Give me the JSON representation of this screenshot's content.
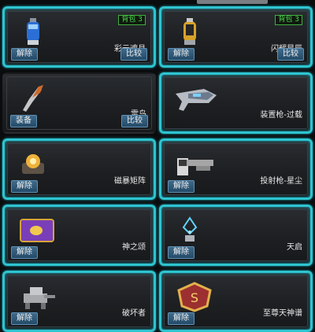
{
  "items": [
    {
      "name": "彩云遮月",
      "badge": "背包 3",
      "primary": "解除",
      "secondary": "比较",
      "icon": "blue-armor-icon",
      "selected": true
    },
    {
      "name": "闪耀星辰",
      "badge": "背包 3",
      "primary": "解除",
      "secondary": "比较",
      "icon": "gold-armor-icon",
      "selected": true
    },
    {
      "name": "雷鸟",
      "badge": "",
      "primary": "装备",
      "secondary": "比较",
      "icon": "thunderbird-weapon-icon",
      "selected": false
    },
    {
      "name": "装置枪-过载",
      "badge": "",
      "primary": "",
      "secondary": "",
      "icon": "device-gun-overload-icon",
      "selected": true
    },
    {
      "name": "磁暴矩阵",
      "badge": "",
      "primary": "解除",
      "secondary": "",
      "icon": "magnetic-matrix-icon",
      "selected": true
    },
    {
      "name": "投射枪-星尘",
      "badge": "",
      "primary": "解除",
      "secondary": "",
      "icon": "projectile-gun-stardust-icon",
      "selected": true
    },
    {
      "name": "神之颂",
      "badge": "",
      "primary": "解除",
      "secondary": "",
      "icon": "purple-scroll-icon",
      "selected": true
    },
    {
      "name": "天启",
      "badge": "",
      "primary": "解除",
      "secondary": "",
      "icon": "apocalypse-pet-icon",
      "selected": true
    },
    {
      "name": "破坏者",
      "badge": "",
      "primary": "解除",
      "secondary": "",
      "icon": "destroyer-mech-icon",
      "selected": true
    },
    {
      "name": "至尊天神谱",
      "badge": "",
      "primary": "解除",
      "secondary": "",
      "icon": "supreme-emblem-icon",
      "selected": true
    }
  ],
  "colors": {
    "accent": "#2ec4d0",
    "badge": "#4bd64b",
    "button": "#2f5a7c"
  }
}
